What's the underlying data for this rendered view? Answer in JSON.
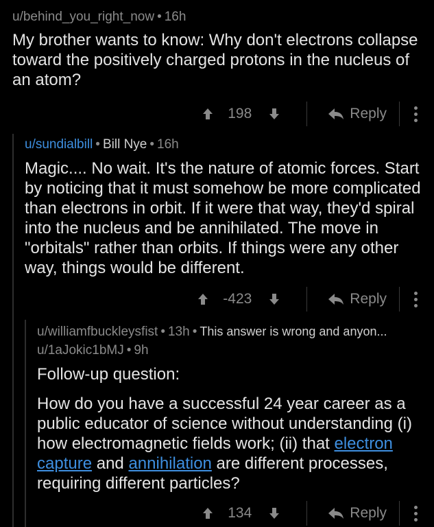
{
  "comment1": {
    "user": "u/behind_you_right_now",
    "sep": "•",
    "age": "16h",
    "text": "My brother wants to know: Why don't electrons collapse toward the positively charged protons in the nucleus of an atom?",
    "score": "198",
    "reply_label": "Reply"
  },
  "comment2": {
    "user": "u/sundialbill",
    "sep": "•",
    "flair": "Bill Nye",
    "sep2": "•",
    "age": "16h",
    "text": "Magic.... No wait. It's the nature of atomic forces. Start by noticing that it must somehow be more complicated than electrons in orbit. If it were that way, they'd spiral into the nucleus and be annihilated. The move in \"orbitals\" rather than orbits. If things were any other way, things would be different.",
    "score": "-423",
    "reply_label": "Reply"
  },
  "collapsed": {
    "user": "u/williamfbuckleysfist",
    "sep": "•",
    "age": "13h",
    "sep2": "•",
    "preview": "This answer is wrong and anyon..."
  },
  "comment3": {
    "user": "u/1aJokic1bMJ",
    "sep": "•",
    "age": "9h",
    "para1": "Follow-up question:",
    "para2_a": "How do you have a successful 24 year career as a public educator of science without understanding (i) how electromagnetic fields work; (ii) that ",
    "link1": "electron capture",
    "para2_b": " and ",
    "link2": "annihilation",
    "para2_c": " are different processes, requiring different particles?",
    "score": "134",
    "reply_label": "Reply"
  },
  "icons": {
    "upvote": "arrow-up-icon",
    "downvote": "arrow-down-icon",
    "reply": "reply-arrow-icon",
    "more": "more-vertical-icon"
  },
  "colors": {
    "background": "#000000",
    "text": "#e4e4e4",
    "muted": "#8a8a8a",
    "link": "#3e8fe0"
  }
}
